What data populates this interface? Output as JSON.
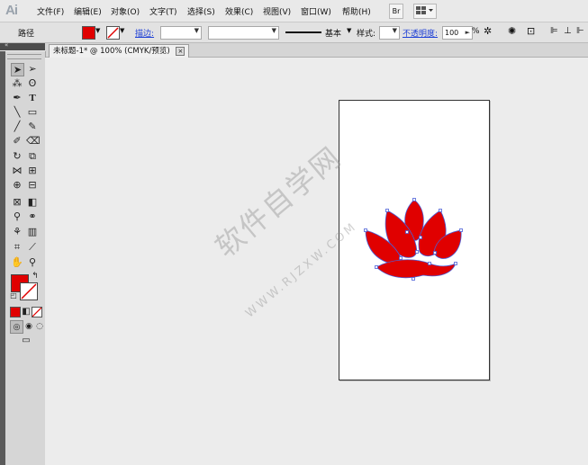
{
  "app": {
    "logo": "Ai"
  },
  "menu": [
    "文件(F)",
    "编辑(E)",
    "对象(O)",
    "文字(T)",
    "选择(S)",
    "效果(C)",
    "视图(V)",
    "窗口(W)",
    "帮助(H)"
  ],
  "menubar_buttons": {
    "bridge": "Br"
  },
  "control": {
    "path_label": "路径",
    "stroke_label": "描边:",
    "basic_label": "基本",
    "style_label": "样式:",
    "opacity_label": "不透明度:",
    "opacity_value": "100",
    "opacity_unit": "%"
  },
  "document": {
    "tab_title": "未标题-1* @ 100% (CMYK/预览)",
    "close": "×"
  },
  "watermark": {
    "main": "软件自学网",
    "sub": "WWW.RJZXW.COM"
  },
  "colors": {
    "fill": "#e00000",
    "accent_link": "#1d3fd6",
    "path_selection": "#4a5fd8"
  }
}
